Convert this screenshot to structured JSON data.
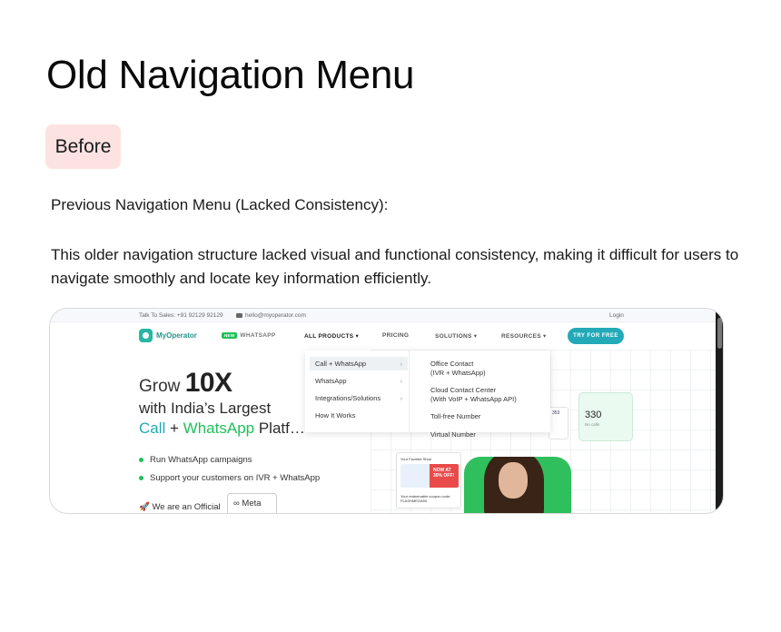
{
  "page": {
    "title": "Old Navigation Menu",
    "badge": "Before",
    "heading": "Previous Navigation Menu (Lacked Consistency):",
    "body": "This older navigation structure lacked visual and functional consistency, making it difficult for users to navigate smoothly and locate key information efficiently."
  },
  "screenshot": {
    "topbar": {
      "talk": "Talk To Sales: +91 92129 92129",
      "email": "hello@myoperator.com",
      "login": "Login"
    },
    "nav": {
      "logo": "MyOperator",
      "wa_new": "NEW",
      "whatsapp": "WHATSAPP",
      "all_products": "ALL PRODUCTS ▾",
      "pricing": "PRICING",
      "solutions": "SOLUTIONS ▾",
      "resources": "RESOURCES ▾",
      "cta": "TRY FOR FREE"
    },
    "hero": {
      "grow": "Grow ",
      "tenx": "10X",
      "line2": "with India’s Largest",
      "call": "Call",
      "plus": " + ",
      "whatsapp": "WhatsApp",
      "rest": " Platf…",
      "bullet1": "Run WhatsApp campaigns",
      "bullet2": "Support your customers on IVR + WhatsApp",
      "official": "🚀 We are an Official",
      "meta": "∞ Meta"
    },
    "dropdown": {
      "left": [
        {
          "label": "Call + WhatsApp",
          "arrow": "›"
        },
        {
          "label": "WhatsApp",
          "arrow": "›"
        },
        {
          "label": "Integrations/Solutions",
          "arrow": "›"
        },
        {
          "label": "How It Works",
          "arrow": ""
        }
      ],
      "right": [
        "Office Contact\n(IVR + WhatsApp)",
        "Cloud Contact Center\n(With VoIP + WhatsApp API)",
        "Toll-free Number",
        "Virtual Number"
      ]
    },
    "stats": {
      "num": "330",
      "sub": "No calls",
      "mini": "353"
    },
    "promo": {
      "head": "Your Favorite Shoe",
      "tag": "NOW AT 30% OFF!",
      "code": "Your redeemable coupon code: FLASHMEGA50"
    }
  }
}
